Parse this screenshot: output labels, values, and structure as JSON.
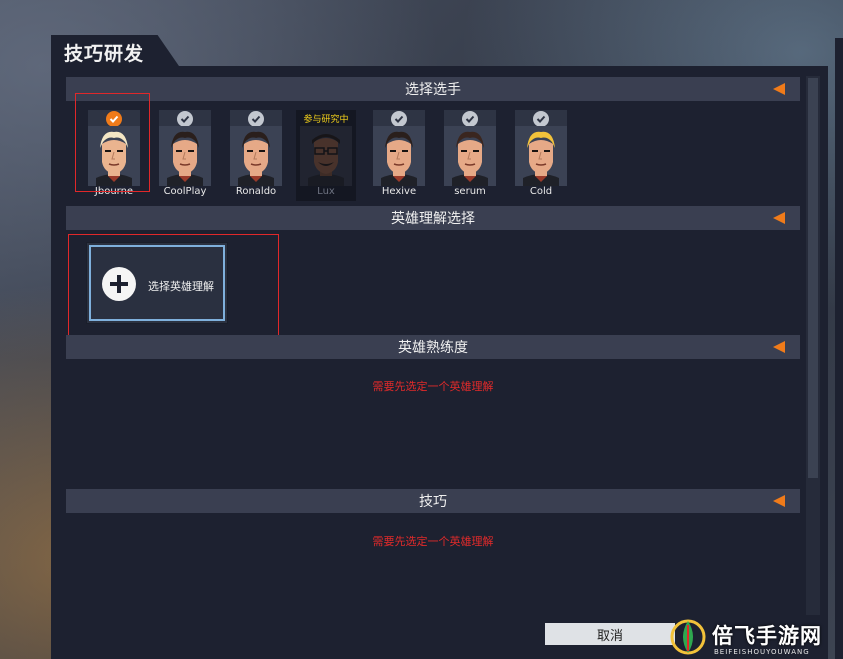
{
  "window": {
    "title": "技巧研发"
  },
  "sections": {
    "select_player": "选择选手",
    "hero_understanding": "英雄理解选择",
    "hero_mastery": "英雄熟练度",
    "skills": "技巧"
  },
  "players": [
    {
      "name": "Jbourne",
      "selected": true,
      "hair": "#f3e6c4",
      "skin": "#eab48f"
    },
    {
      "name": "CoolPlay",
      "selected": false,
      "hair": "#2a1f1c",
      "skin": "#e6a987"
    },
    {
      "name": "Ronaldo",
      "selected": false,
      "hair": "#2a1f1c",
      "skin": "#e6a987"
    },
    {
      "name": "Hexive",
      "selected": false,
      "hair": "#2a1f1c",
      "skin": "#e6a987"
    },
    {
      "name": "serum",
      "selected": false,
      "hair": "#3a261f",
      "skin": "#e6a987"
    },
    {
      "name": "Cold",
      "selected": false,
      "hair": "#f2c23a",
      "skin": "#e6a987"
    }
  ],
  "locked_player": {
    "name": "Lux",
    "badge": "参与研究中"
  },
  "add_understanding": {
    "label": "选择英雄理解"
  },
  "messages": {
    "need_understanding_mastery": "需要先选定一个英雄理解",
    "need_understanding_skills": "需要先选定一个英雄理解"
  },
  "buttons": {
    "cancel": "取消"
  },
  "watermark": {
    "text": "倍飞手游网",
    "sub": "BEIFEISHOUYOUWANG"
  },
  "colors": {
    "accent": "#f07b1a",
    "panel": "#1d2130",
    "header": "#3a3f51",
    "warning": "#e02a2a",
    "highlight": "#e0282a"
  }
}
